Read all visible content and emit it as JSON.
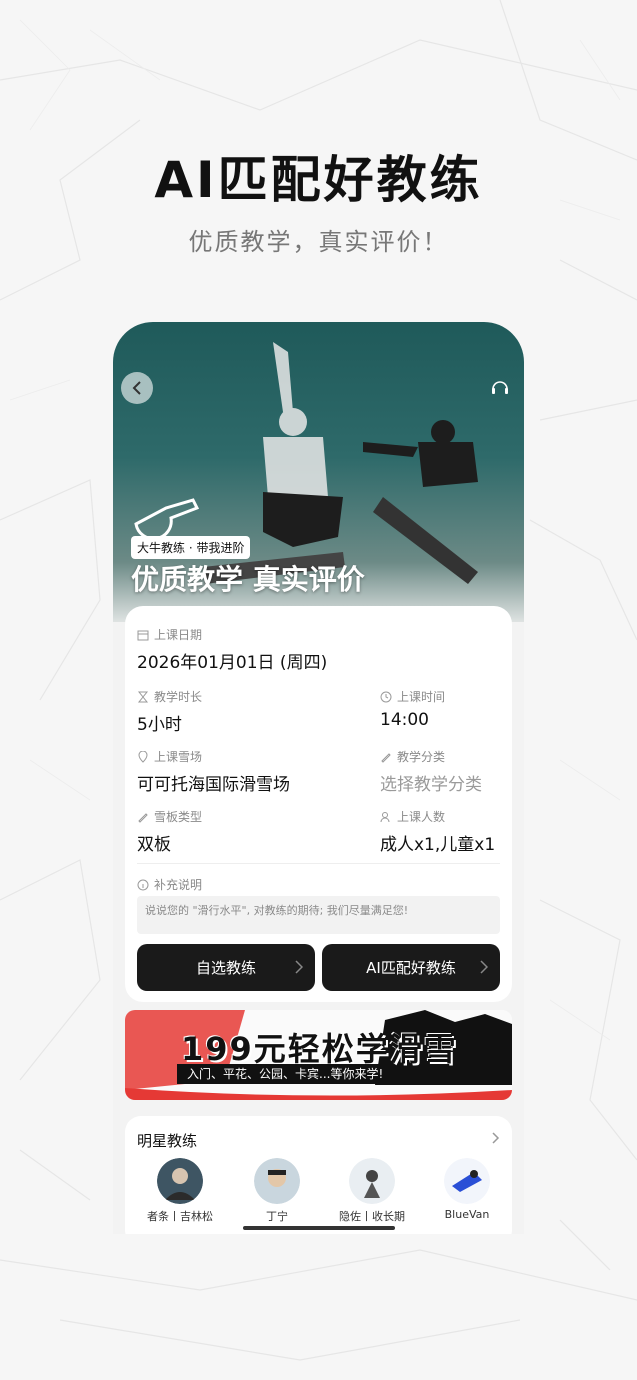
{
  "headline": "AI匹配好教练",
  "subhead": "优质教学，真实评价！",
  "hero": {
    "tag": "大牛教练 · 带我进阶",
    "title": "优质教学 真实评价"
  },
  "form": {
    "date": {
      "label": "上课日期",
      "value": "2026年01月01日 (周四)"
    },
    "duration": {
      "label": "教学时长",
      "value": "5小时"
    },
    "time": {
      "label": "上课时间",
      "value": "14:00"
    },
    "resort": {
      "label": "上课雪场",
      "value": "可可托海国际滑雪场"
    },
    "category": {
      "label": "教学分类",
      "placeholder": "选择教学分类"
    },
    "board": {
      "label": "雪板类型",
      "value": "双板"
    },
    "people": {
      "label": "上课人数",
      "value": "成人x1,儿童x1"
    },
    "notes": {
      "label": "补充说明",
      "placeholder": "说说您的 \"滑行水平\", 对教练的期待; 我们尽量满足您!"
    },
    "choose_button": "自选教练",
    "ai_button": "AI匹配好教练"
  },
  "banner": {
    "title": "199元轻松学滑雪",
    "subtitle": "入门、平花、公园、卡宾...等你来学!"
  },
  "coaches": {
    "title": "明星教练",
    "items": [
      {
        "name": "者条丨吉林松"
      },
      {
        "name": "丁宁"
      },
      {
        "name": "隐佐丨收长期"
      },
      {
        "name": "BlueVan"
      }
    ]
  },
  "colors": {
    "button_bg": "#1a1a1a",
    "hero_teal": "#2e6a6a",
    "banner_red": "#e53935"
  }
}
